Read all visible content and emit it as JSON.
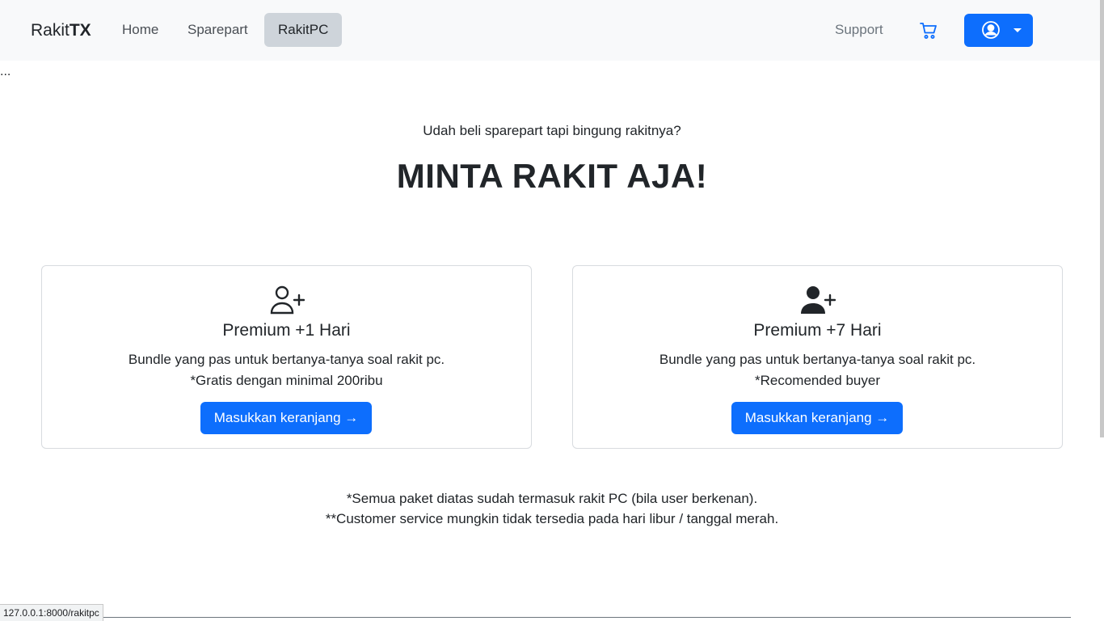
{
  "navbar": {
    "brand_light": "Rakit",
    "brand_bold": "TX",
    "links": [
      {
        "label": "Home"
      },
      {
        "label": "Sparepart"
      },
      {
        "label": "RakitPC",
        "active": true
      }
    ],
    "support_label": "Support",
    "cart_icon": "cart-icon",
    "account_icon": "user-circle-icon"
  },
  "ellipsis": "...",
  "hero": {
    "subtitle": "Udah beli sparepart tapi bingung rakitnya?",
    "headline": "MINTA RAKIT AJA!"
  },
  "cards": [
    {
      "icon": "person-plus-outline-icon",
      "title": "Premium +1 Hari",
      "desc_line1": "Bundle yang pas untuk bertanya-tanya soal rakit pc.",
      "desc_line2": "*Gratis dengan minimal 200ribu",
      "button_label": "Masukkan keranjang →"
    },
    {
      "icon": "person-plus-filled-icon",
      "title": "Premium +7 Hari",
      "desc_line1": "Bundle yang pas untuk bertanya-tanya soal rakit pc.",
      "desc_line2": "*Recomended buyer",
      "button_label": "Masukkan keranjang →"
    }
  ],
  "footnotes": {
    "line1": "*Semua paket diatas sudah termasuk rakit PC (bila user berkenan).",
    "line2": "**Customer service mungkin tidak tersedia pada hari libur / tanggal merah."
  },
  "statusbar": {
    "url": "127.0.0.1:8000/rakitpc"
  },
  "colors": {
    "primary": "#0d6efd",
    "navbar_bg": "#f8f9fa",
    "active_link_bg": "#ced4da",
    "text": "#212529"
  }
}
